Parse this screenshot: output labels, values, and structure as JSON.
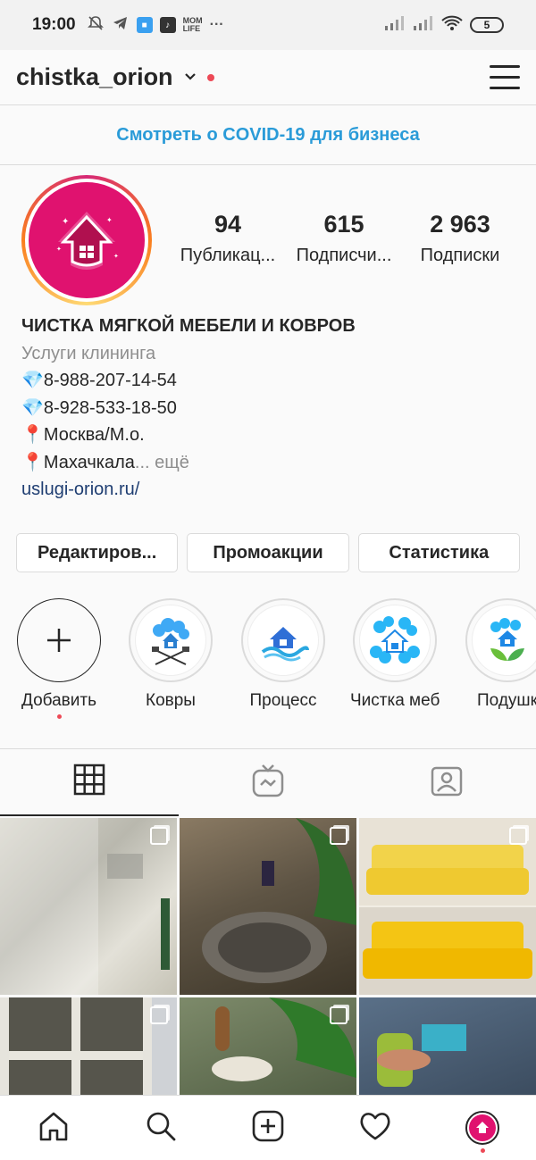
{
  "status_bar": {
    "time": "19:00",
    "battery": "5",
    "icons": [
      "mute-icon",
      "telegram-icon",
      "app-icon",
      "tiktok-icon",
      "mom-life-icon",
      "more-icon",
      "signal-icon",
      "signal-icon",
      "wifi-icon",
      "battery-icon"
    ],
    "mom_life": "MOM LIFE",
    "more": "···"
  },
  "header": {
    "username": "chistka_orion",
    "chevron": "⌄"
  },
  "banner": {
    "covid_link": "Смотреть о COVID-19 для бизнеса"
  },
  "profile": {
    "stats": [
      {
        "value": "94",
        "label": "Публикац..."
      },
      {
        "value": "615",
        "label": "Подписчи..."
      },
      {
        "value": "2 963",
        "label": "Подписки"
      }
    ],
    "bio": {
      "name": "ЧИСТКА МЯГКОЙ МЕБЕЛИ И КОВРОВ",
      "category": "Услуги клининга",
      "lines": [
        "💎8-988-207-14-54",
        "💎8-928-533-18-50",
        "📍Москва/М.о."
      ],
      "last_line": "📍Махачкала",
      "more": "... ещё",
      "link": "uslugi-orion.ru/"
    }
  },
  "actions": {
    "edit": "Редактиров...",
    "promo": "Промоакции",
    "stats": "Статистика"
  },
  "highlights": [
    {
      "label": "Добавить"
    },
    {
      "label": "Ковры"
    },
    {
      "label": "Процесс"
    },
    {
      "label": "Чистка меб..."
    },
    {
      "label": "Подушк"
    }
  ],
  "tabs": [
    "grid-icon",
    "igtv-icon",
    "tagged-icon"
  ],
  "colors": {
    "accent_link": "#2a9bd8",
    "brand_pink": "#e0126f",
    "notification_red": "#ed4956"
  },
  "bottom_nav": [
    "home-icon",
    "search-icon",
    "new-post-icon",
    "heart-icon",
    "profile-avatar"
  ]
}
